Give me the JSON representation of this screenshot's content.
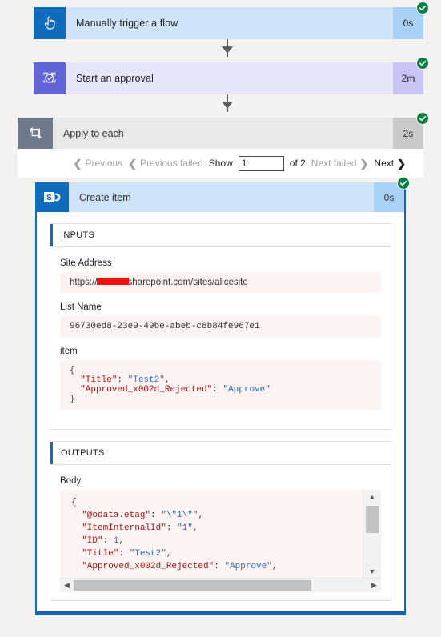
{
  "flow": {
    "trigger": {
      "title": "Manually trigger a flow",
      "duration": "0s",
      "icon": "hand-pointer-icon",
      "status": "succeeded"
    },
    "approval": {
      "title": "Start an approval",
      "duration": "2m",
      "icon": "approval-check-icon",
      "status": "succeeded"
    },
    "scope": {
      "title": "Apply to each",
      "duration": "2s",
      "icon": "loop-icon",
      "status": "succeeded"
    },
    "action": {
      "title": "Create item",
      "duration": "0s",
      "icon": "sharepoint-icon",
      "status": "succeeded"
    }
  },
  "pager": {
    "previous": "Previous",
    "previous_failed": "Previous failed",
    "show_label": "Show",
    "page_value": "1",
    "page_placeholder": "",
    "of_label": "of 2",
    "next_failed": "Next failed",
    "next": "Next"
  },
  "inputs": {
    "section_title": "INPUTS",
    "site_address": {
      "label": "Site Address",
      "prefix": "https://",
      "redacted": true,
      "suffix": "sharepoint.com/sites/alicesite"
    },
    "list_name": {
      "label": "List Name",
      "value": "96730ed8-23e9-49be-abeb-c8b84fe967e1"
    },
    "item": {
      "label": "item",
      "lines": [
        {
          "punc": "{"
        },
        {
          "key": "\"Title\"",
          "sep": ": ",
          "val": "\"Test2\"",
          "tail": ","
        },
        {
          "key": "\"Approved_x002d_Rejected\"",
          "sep": ": ",
          "val": "\"Approve\"",
          "tail": ""
        },
        {
          "punc": "}"
        }
      ]
    }
  },
  "outputs": {
    "section_title": "OUTPUTS",
    "body": {
      "label": "Body",
      "lines": [
        {
          "punc": "{"
        },
        {
          "key": "\"@odata.etag\"",
          "sep": ": ",
          "val": "\"\\\"1\\\"\"",
          "tail": ","
        },
        {
          "key": "\"ItemInternalId\"",
          "sep": ": ",
          "val": "\"1\"",
          "tail": ","
        },
        {
          "key": "\"ID\"",
          "sep": ": ",
          "val": "1",
          "tail": ",",
          "numeric": true
        },
        {
          "key": "\"Title\"",
          "sep": ": ",
          "val": "\"Test2\"",
          "tail": ","
        },
        {
          "key": "\"Approved_x002d_Rejected\"",
          "sep": ": ",
          "val": "\"Approve\"",
          "tail": ","
        }
      ]
    }
  },
  "colors": {
    "trigger_accent": "#0f6cbd",
    "approval_accent": "#6264d8",
    "scope_accent": "#6f7b8b",
    "sharepoint_accent": "#0f6cbd",
    "success_badge": "#0b8043",
    "code_bg": "#fdf3f3",
    "page_bg": "#f3f2f1"
  }
}
